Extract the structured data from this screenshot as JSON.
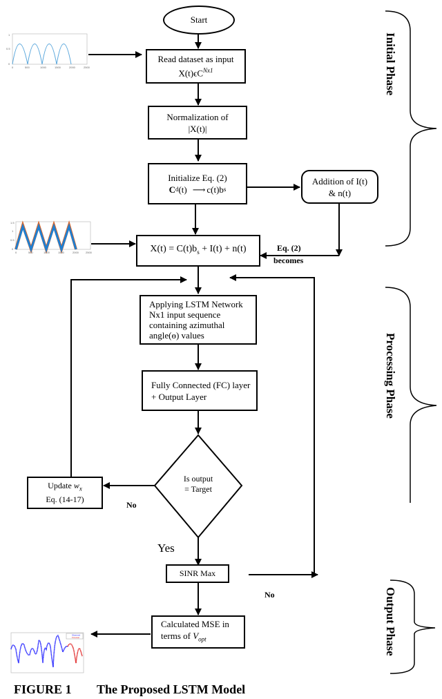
{
  "nodes": {
    "start": "Start",
    "read_dataset": {
      "line1": "Read dataset as input",
      "line2_prefix": "X(t)ϵC",
      "line2_sup": "Nx1"
    },
    "normalization": {
      "line1": "Normalization of",
      "line2": "|X(t)|"
    },
    "initialize": {
      "line1": "Initialize Eq. (2)",
      "line2_left": "C",
      "line2_left_sub": "d",
      "line2_left_suffix": "(t)",
      "line2_right": "c(t)b",
      "line2_right_sub": "s"
    },
    "addition": {
      "line1": "Addition of I(t)",
      "line2": "& n(t)"
    },
    "signal_eq": {
      "prefix": "X(t) = C(t)b",
      "sub": "s",
      "suffix": " + I(t) +  n(t)"
    },
    "lstm": {
      "line1": "Applying LSTM Network",
      "line2": "Nx1 input sequence",
      "line3": "containing azimuthal",
      "line4": "angle(ɵ) values"
    },
    "fc_layer": {
      "line1": "Fully Connected (FC) layer",
      "line2": "+ Output Layer"
    },
    "decision": {
      "line1": "Is output",
      "line2": "= Target"
    },
    "update": {
      "line1_prefix": "Update ",
      "line1_var": "w",
      "line1_sub": "x",
      "line2": "Eq. (14-17)"
    },
    "sinr": "SINR Max",
    "mse": {
      "line1": "Calculated MSE in",
      "line2_prefix": "terms of ",
      "line2_var": "V",
      "line2_sub": "opt"
    }
  },
  "edge_labels": {
    "eq2_becomes_1": "Eq. (2)",
    "eq2_becomes_2": "becomes",
    "no_left": "No",
    "yes": "Yes",
    "no_right": "No"
  },
  "phases": {
    "initial": "Initial Phase",
    "processing": "Processing Phase",
    "output": "Output Phase"
  },
  "thumbnails": {
    "input_plot": {
      "yticks": [
        "1",
        "0.5",
        "0"
      ],
      "xticks": [
        "0",
        "500",
        "1000",
        "1500",
        "2000",
        "2500"
      ]
    },
    "noisy_plot": {
      "yticks": [
        "1.5",
        "1",
        "0.5",
        "0"
      ],
      "xticks": [
        "0",
        "500",
        "1000",
        "1500",
        "2000",
        "2500"
      ]
    },
    "output_plot": {
      "legend": [
        "Observed",
        "Forecast"
      ],
      "colors": {
        "observed": "#1a1aff",
        "forecast": "#e02020"
      }
    }
  },
  "caption": {
    "figure": "FIGURE 1",
    "title": "The Proposed LSTM Model"
  }
}
